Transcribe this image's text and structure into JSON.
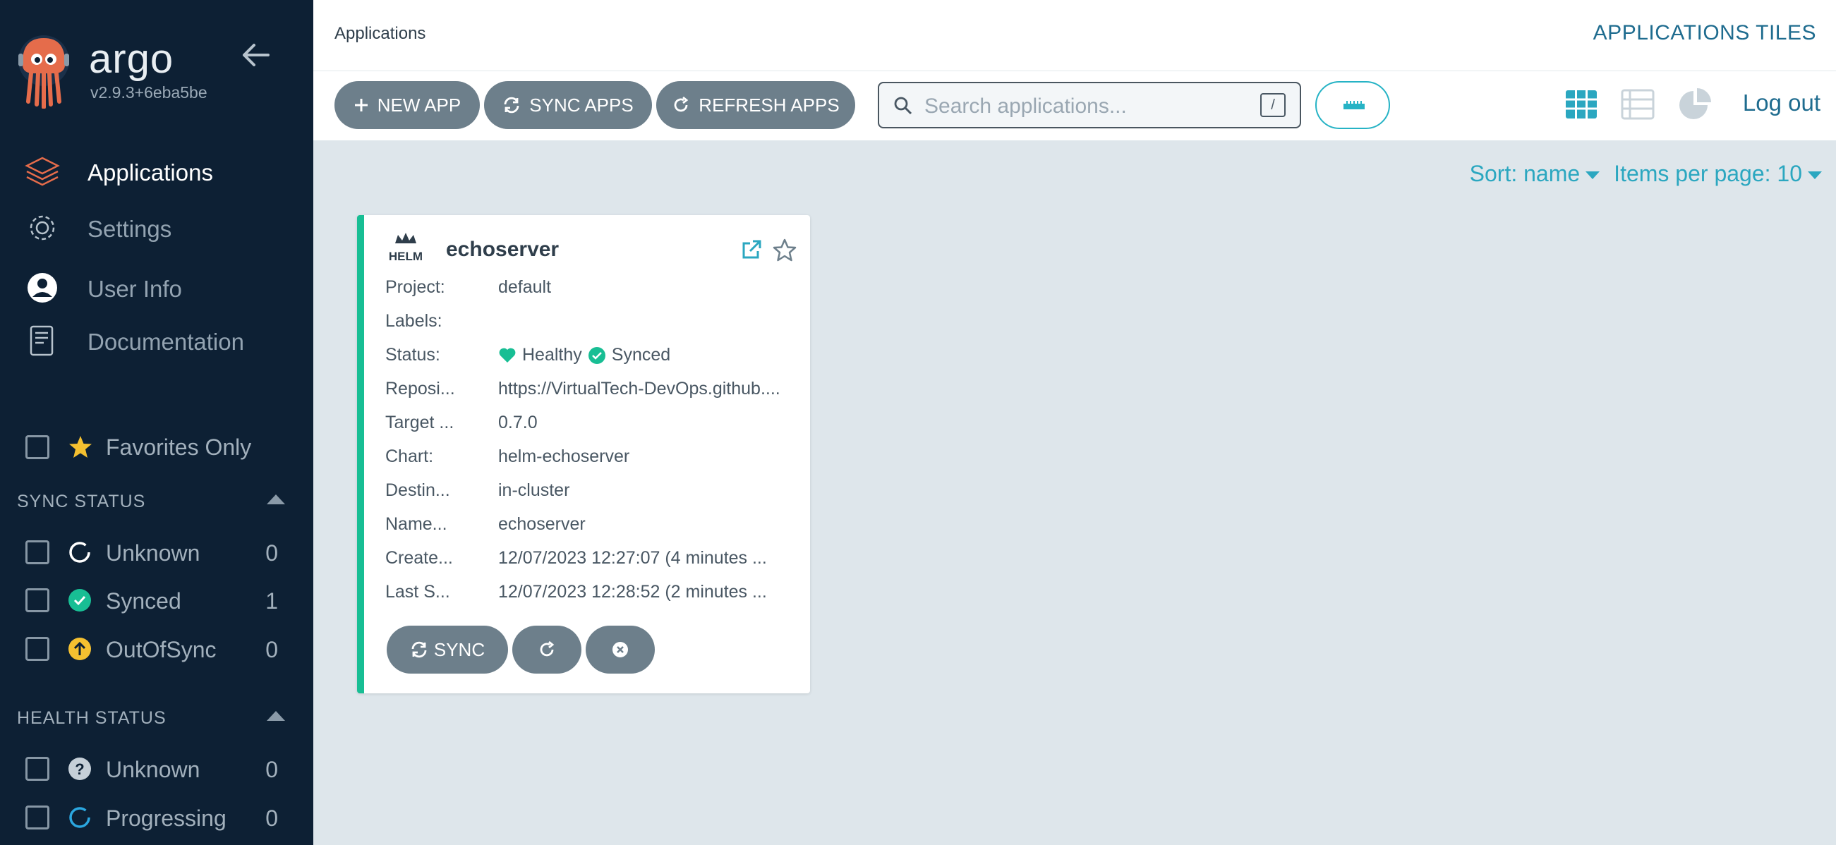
{
  "sidebar": {
    "brand": "argo",
    "version": "v2.9.3+6eba5be",
    "nav": [
      {
        "label": "Applications"
      },
      {
        "label": "Settings"
      },
      {
        "label": "User Info"
      },
      {
        "label": "Documentation"
      }
    ],
    "favorites_label": "Favorites Only",
    "sync_status": {
      "title": "SYNC STATUS",
      "items": [
        {
          "label": "Unknown",
          "count": "0"
        },
        {
          "label": "Synced",
          "count": "1"
        },
        {
          "label": "OutOfSync",
          "count": "0"
        }
      ]
    },
    "health_status": {
      "title": "HEALTH STATUS",
      "items": [
        {
          "label": "Unknown",
          "count": "0"
        },
        {
          "label": "Progressing",
          "count": "0"
        }
      ]
    }
  },
  "topbar": {
    "breadcrumb": "Applications",
    "title_right": "APPLICATIONS TILES"
  },
  "toolbar": {
    "new_app": "NEW APP",
    "sync_apps": "SYNC APPS",
    "refresh_apps": "REFRESH APPS",
    "search_placeholder": "Search applications...",
    "search_shortcut": "/",
    "logout": "Log out"
  },
  "sort": {
    "sort_label": "Sort: name",
    "per_page_label": "Items per page: 10"
  },
  "app": {
    "name": "echoserver",
    "rows": [
      {
        "key": "Project:",
        "value": "default"
      },
      {
        "key": "Labels:",
        "value": ""
      },
      {
        "key": "Status:",
        "value": ""
      },
      {
        "key": "Reposi...",
        "value": "https://VirtualTech-DevOps.github...."
      },
      {
        "key": "Target ...",
        "value": "0.7.0"
      },
      {
        "key": "Chart:",
        "value": "helm-echoserver"
      },
      {
        "key": "Destin...",
        "value": "in-cluster"
      },
      {
        "key": "Name...",
        "value": "echoserver"
      },
      {
        "key": "Create...",
        "value": "12/07/2023 12:27:07  (4 minutes ..."
      },
      {
        "key": "Last S...",
        "value": "12/07/2023 12:28:52  (2 minutes ..."
      }
    ],
    "health": "Healthy",
    "sync": "Synced",
    "sync_button": "SYNC"
  },
  "colors": {
    "sidebar_bg": "#0d2034",
    "accent": "#18be94",
    "link": "#2ba7c0",
    "button": "#6d7f8b",
    "warning": "#f4c030"
  },
  "icons": {
    "nav": [
      "layers-icon",
      "gear-icon",
      "user-circle-icon",
      "docs-icon"
    ],
    "toolbar": [
      "plus-icon",
      "sync-icon",
      "refresh-icon",
      "search-icon",
      "filter-icon",
      "tiles-view-icon",
      "list-view-icon",
      "pie-chart-icon"
    ],
    "tile": [
      "helm-icon",
      "external-link-icon",
      "star-icon",
      "heart-icon",
      "check-circle-icon"
    ]
  }
}
